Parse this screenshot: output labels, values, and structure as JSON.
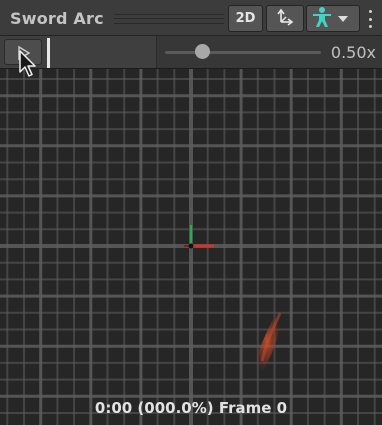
{
  "window": {
    "title": "Sword Arc"
  },
  "toolbar": {
    "mode_2d_label": "2D",
    "gizmo_icon": "pivot-gizmo-icon",
    "avatar_icon": "avatar-humanoid-icon",
    "avatar_menu_icon": "caret-down-icon",
    "more_icon": "kebab-menu-icon"
  },
  "playback": {
    "play_icon": "play-icon",
    "speed_label": "0.50x",
    "speed_fraction": 0.24
  },
  "viewport": {
    "frame_readout": "0:00 (000.0%) Frame 0"
  },
  "colors": {
    "toolbar_bg": "#3c3c3c",
    "viewport_bg": "#262626",
    "grid_line": "#5e5e5e",
    "axis_y": "#22b14c",
    "axis_x": "#d0352a",
    "accent_avatar": "#41d3c4",
    "slash_effect": "#c84b2a"
  }
}
